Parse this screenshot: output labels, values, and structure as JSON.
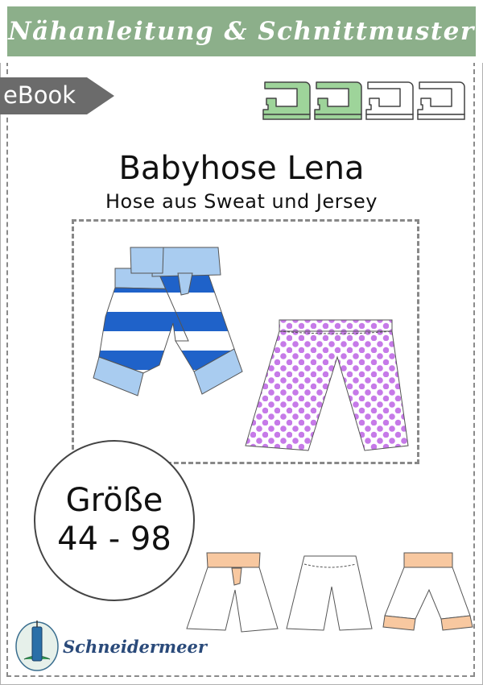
{
  "header": {
    "title": "Nähanleitung & Schnittmuster"
  },
  "badge": {
    "label": "eBook"
  },
  "difficulty": {
    "icon": "sewing-machine-icon",
    "filled": 2,
    "total": 4,
    "filled_color": "#9ed49a"
  },
  "product": {
    "title": "Babyhose Lena",
    "subtitle": "Hose aus Sweat und Jersey"
  },
  "size": {
    "label": "Größe",
    "range": "44 - 98"
  },
  "brand": {
    "name": "Schneidermeer"
  },
  "colors": {
    "header_bg": "#8caf8a",
    "badge_bg": "#6b6b6b",
    "stripe_blue": "#1f62c9",
    "cuff_light_blue": "#a9ccf0",
    "dot_purple": "#c67ae8",
    "variant_peach": "#f8c8a0",
    "brand_blue": "#2a4a7a"
  }
}
